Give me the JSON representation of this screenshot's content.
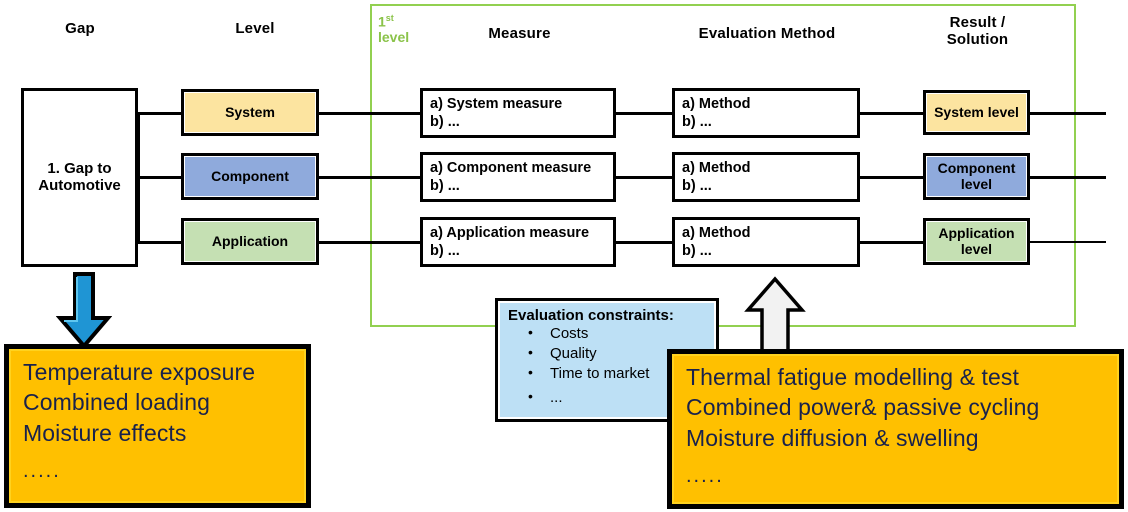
{
  "headers": {
    "gap": "Gap",
    "level": "Level",
    "level_tag_number": "1",
    "level_tag_sup": "st",
    "level_tag_word": "level",
    "measure": "Measure",
    "evaluation_method": "Evaluation Method",
    "result_line1": "Result /",
    "result_line2": "Solution"
  },
  "gap_box": {
    "line1": "1. Gap to",
    "line2": "Automotive"
  },
  "levels": [
    {
      "label": "System",
      "color": "#FCE4A0"
    },
    {
      "label": "Component",
      "color": "#8FAADC"
    },
    {
      "label": "Application",
      "color": "#C5E0B3"
    }
  ],
  "measures": [
    {
      "a": "a) System measure",
      "b": "b) ..."
    },
    {
      "a": "a) Component measure",
      "b": "b) ..."
    },
    {
      "a": "a) Application measure",
      "b": "b) ..."
    }
  ],
  "methods": [
    {
      "a": "a) Method",
      "b": "b) ..."
    },
    {
      "a": "a) Method",
      "b": "b) ..."
    },
    {
      "a": "a) Method",
      "b": "b) ..."
    }
  ],
  "results": [
    {
      "line1": "System level",
      "line2": "",
      "color": "#FCE4A0"
    },
    {
      "line1": "Component",
      "line2": "level",
      "color": "#8FAADC"
    },
    {
      "line1": "Application",
      "line2": "level",
      "color": "#C5E0B3"
    }
  ],
  "constraints": {
    "title": "Evaluation constraints:",
    "items": [
      "Costs",
      "Quality",
      "Time to market",
      "..."
    ]
  },
  "callout_left": {
    "line1": "Temperature  exposure",
    "line2": "Combined  loading",
    "line3": "Moisture  effects",
    "dots": "....."
  },
  "callout_right": {
    "line1": "Thermal  fatigue  modelling  &  test",
    "line2": "Combined  power&  passive  cycling",
    "line3": "Moisture  diffusion  &  swelling",
    "dots": "....."
  },
  "colors": {
    "green_frame": "#92D050",
    "level_tag": "#8BC34A",
    "orange": "#FFC000",
    "orange_text": "#19224C",
    "constraints_bg": "#BDE0F5",
    "arrow_blue": "#1F95D4"
  }
}
